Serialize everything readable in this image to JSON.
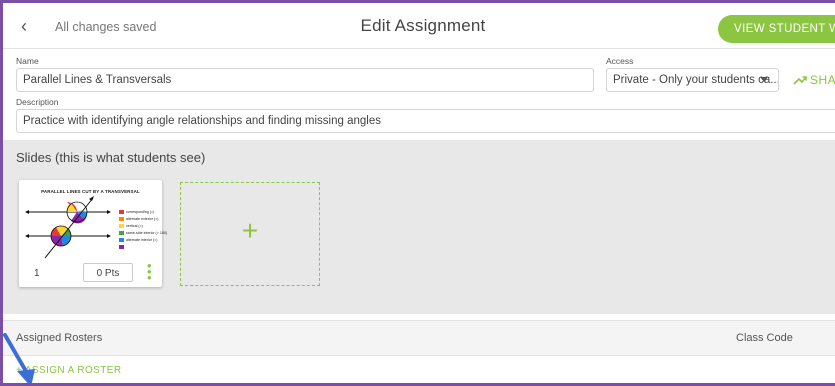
{
  "topbar": {
    "back_icon": "chevron-left-icon",
    "saved_status": "All changes saved",
    "title": "Edit Assignment",
    "view_button": "VIEW STUDENT WORK"
  },
  "form": {
    "name_label": "Name",
    "name_value": "Parallel Lines & Transversals",
    "access_label": "Access",
    "access_value": "Private - Only your students ca...",
    "share_label": "SHARE",
    "share_icon": "share-icon",
    "description_label": "Description",
    "description_value": "Practice with identifying angle relationships and finding missing angles"
  },
  "slides": {
    "section_title": "Slides (this is what students see)",
    "items": [
      {
        "title": "PARALLEL LINES CUT BY A TRANSVERSAL",
        "number": "1",
        "points": "0 Pts",
        "legend": [
          {
            "text": "corresponding (=)",
            "color": "#e53935"
          },
          {
            "text": "alternate exterior (=)",
            "color": "#fb8c00"
          },
          {
            "text": "vertical (=)",
            "color": "#fdd835"
          },
          {
            "text": "same-side interior (= 180)",
            "color": "#43a047"
          },
          {
            "text": "alternate interior (=)",
            "color": "#1e88e5"
          },
          {
            "text": "",
            "color": "#8e24aa"
          }
        ]
      }
    ],
    "add_symbol": "+"
  },
  "rosters": {
    "header_left": "Assigned Rosters",
    "header_right": "Class Code",
    "assign_link": "+ ASSIGN A ROSTER"
  },
  "colors": {
    "accent": "#8bc542",
    "frame": "#7a4fa8",
    "annotation_arrow": "#3b6fd6"
  }
}
